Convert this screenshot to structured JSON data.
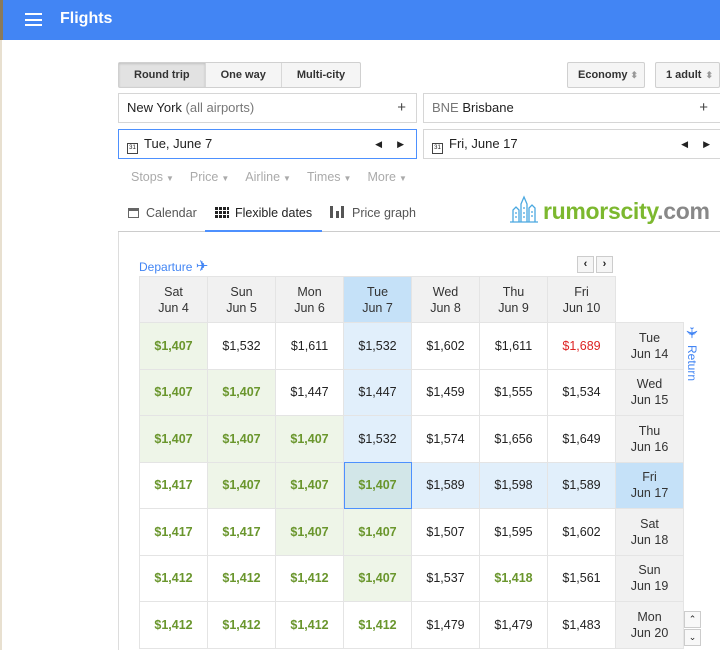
{
  "header": {
    "title": "Flights",
    "colors": {
      "bar": "#4285f4"
    }
  },
  "trip_type": {
    "options": [
      "Round trip",
      "One way",
      "Multi-city"
    ],
    "selected": "Round trip"
  },
  "cabin": "Economy",
  "passengers": "1 adult",
  "origin": {
    "city": "New York",
    "detail": "(all airports)"
  },
  "destination": {
    "code": "BNE",
    "city": "Brisbane"
  },
  "depart_date": "Tue, June 7",
  "return_date": "Fri, June 17",
  "calendar_icon_text": "31",
  "filters": [
    "Stops",
    "Price",
    "Airline",
    "Times",
    "More"
  ],
  "view_tabs": [
    {
      "label": "Calendar",
      "icon": "calendar-icon"
    },
    {
      "label": "Flexible dates",
      "icon": "grid-icon",
      "active": true
    },
    {
      "label": "Price graph",
      "icon": "bar-chart-icon"
    }
  ],
  "watermark": {
    "text1": "rumorscity",
    "text2": ".com"
  },
  "grid": {
    "departure_label": "Departure",
    "return_label": "Return",
    "departure_dates": [
      {
        "day": "Sat",
        "date": "Jun 4"
      },
      {
        "day": "Sun",
        "date": "Jun 5"
      },
      {
        "day": "Mon",
        "date": "Jun 6"
      },
      {
        "day": "Tue",
        "date": "Jun 7",
        "selected": true
      },
      {
        "day": "Wed",
        "date": "Jun 8"
      },
      {
        "day": "Thu",
        "date": "Jun 9"
      },
      {
        "day": "Fri",
        "date": "Jun 10"
      }
    ],
    "rows": [
      {
        "day": "Tue",
        "date": "Jun 14",
        "prices": [
          "$1,407",
          "$1,532",
          "$1,611",
          "$1,532",
          "$1,602",
          "$1,611",
          "$1,689"
        ],
        "shade": [
          "g",
          "w",
          "w",
          "b",
          "w",
          "w",
          "w"
        ],
        "tone": [
          "low",
          "normal",
          "normal",
          "normal",
          "normal",
          "normal",
          "high"
        ]
      },
      {
        "day": "Wed",
        "date": "Jun 15",
        "prices": [
          "$1,407",
          "$1,407",
          "$1,447",
          "$1,447",
          "$1,459",
          "$1,555",
          "$1,534"
        ],
        "shade": [
          "g",
          "g",
          "w",
          "b",
          "w",
          "w",
          "w"
        ],
        "tone": [
          "low",
          "low",
          "normal",
          "normal",
          "normal",
          "normal",
          "normal"
        ]
      },
      {
        "day": "Thu",
        "date": "Jun 16",
        "prices": [
          "$1,407",
          "$1,407",
          "$1,407",
          "$1,532",
          "$1,574",
          "$1,656",
          "$1,649"
        ],
        "shade": [
          "g",
          "g",
          "g",
          "b",
          "w",
          "w",
          "w"
        ],
        "tone": [
          "low",
          "low",
          "low",
          "normal",
          "normal",
          "normal",
          "normal"
        ]
      },
      {
        "day": "Fri",
        "date": "Jun 17",
        "selected": true,
        "prices": [
          "$1,417",
          "$1,407",
          "$1,407",
          "$1,407",
          "$1,589",
          "$1,598",
          "$1,589"
        ],
        "shade": [
          "w",
          "g",
          "g",
          "s",
          "b",
          "b",
          "b"
        ],
        "tone": [
          "low",
          "low",
          "low",
          "low",
          "normal",
          "normal",
          "normal"
        ]
      },
      {
        "day": "Sat",
        "date": "Jun 18",
        "prices": [
          "$1,417",
          "$1,417",
          "$1,407",
          "$1,407",
          "$1,507",
          "$1,595",
          "$1,602"
        ],
        "shade": [
          "w",
          "w",
          "g",
          "g",
          "w",
          "w",
          "w"
        ],
        "tone": [
          "low",
          "low",
          "low",
          "low",
          "normal",
          "normal",
          "normal"
        ]
      },
      {
        "day": "Sun",
        "date": "Jun 19",
        "prices": [
          "$1,412",
          "$1,412",
          "$1,412",
          "$1,407",
          "$1,537",
          "$1,418",
          "$1,561"
        ],
        "shade": [
          "w",
          "w",
          "w",
          "g",
          "w",
          "w",
          "w"
        ],
        "tone": [
          "low",
          "low",
          "low",
          "low",
          "normal",
          "low",
          "normal"
        ]
      },
      {
        "day": "Mon",
        "date": "Jun 20",
        "prices": [
          "$1,412",
          "$1,412",
          "$1,412",
          "$1,412",
          "$1,479",
          "$1,479",
          "$1,483"
        ],
        "shade": [
          "w",
          "w",
          "w",
          "w",
          "w",
          "w",
          "w"
        ],
        "tone": [
          "low",
          "low",
          "low",
          "low",
          "normal",
          "normal",
          "normal"
        ]
      }
    ]
  }
}
